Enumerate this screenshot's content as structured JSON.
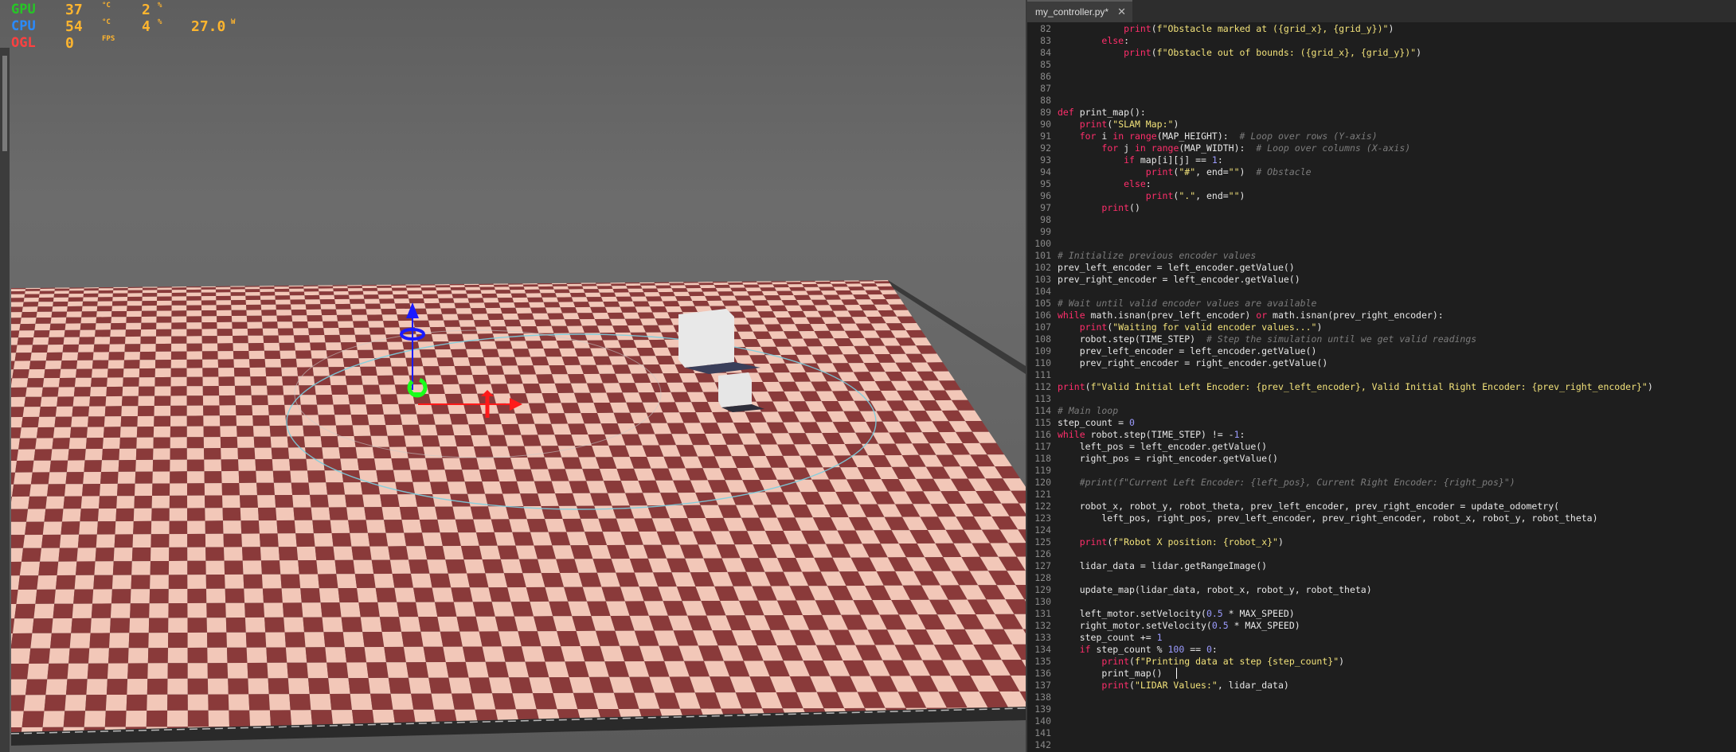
{
  "hud": {
    "rows": [
      {
        "label": "GPU",
        "label_color": "#26c626",
        "v1": "37",
        "u1": "°C",
        "v2": "2",
        "u2": "%",
        "v3": "",
        "u3": ""
      },
      {
        "label": "CPU",
        "label_color": "#2a8bff",
        "v1": "54",
        "u1": "°C",
        "v2": "4",
        "u2": "%",
        "v3": "27.0",
        "u3": "W"
      },
      {
        "label": "OGL",
        "label_color": "#ff4040",
        "v1": "0",
        "u1": "FPS",
        "v2": "",
        "u2": "",
        "v3": "",
        "u3": ""
      }
    ]
  },
  "editor": {
    "tab_title": "my_controller.py*",
    "close_glyph": "✕",
    "lines": [
      {
        "n": "82",
        "t": "            print(f\"Obstacle marked at ({grid_x}, {grid_y})\")"
      },
      {
        "n": "83",
        "t": "        else:"
      },
      {
        "n": "84",
        "t": "            print(f\"Obstacle out of bounds: ({grid_x}, {grid_y})\")"
      },
      {
        "n": "85",
        "t": ""
      },
      {
        "n": "86",
        "t": ""
      },
      {
        "n": "87",
        "t": ""
      },
      {
        "n": "88",
        "t": ""
      },
      {
        "n": "89",
        "t": "def print_map():"
      },
      {
        "n": "90",
        "t": "    print(\"SLAM Map:\")"
      },
      {
        "n": "91",
        "t": "    for i in range(MAP_HEIGHT):  # Loop over rows (Y-axis)"
      },
      {
        "n": "92",
        "t": "        for j in range(MAP_WIDTH):  # Loop over columns (X-axis)"
      },
      {
        "n": "93",
        "t": "            if map[i][j] == 1:"
      },
      {
        "n": "94",
        "t": "                print(\"#\", end=\"\")  # Obstacle"
      },
      {
        "n": "95",
        "t": "            else:"
      },
      {
        "n": "96",
        "t": "                print(\".\", end=\"\")"
      },
      {
        "n": "97",
        "t": "        print()"
      },
      {
        "n": "98",
        "t": ""
      },
      {
        "n": "99",
        "t": ""
      },
      {
        "n": "100",
        "t": ""
      },
      {
        "n": "101",
        "t": "# Initialize previous encoder values"
      },
      {
        "n": "102",
        "t": "prev_left_encoder = left_encoder.getValue()"
      },
      {
        "n": "103",
        "t": "prev_right_encoder = left_encoder.getValue()"
      },
      {
        "n": "104",
        "t": ""
      },
      {
        "n": "105",
        "t": "# Wait until valid encoder values are available"
      },
      {
        "n": "106",
        "t": "while math.isnan(prev_left_encoder) or math.isnan(prev_right_encoder):"
      },
      {
        "n": "107",
        "t": "    print(\"Waiting for valid encoder values...\")"
      },
      {
        "n": "108",
        "t": "    robot.step(TIME_STEP)  # Step the simulation until we get valid readings"
      },
      {
        "n": "109",
        "t": "    prev_left_encoder = left_encoder.getValue()"
      },
      {
        "n": "110",
        "t": "    prev_right_encoder = right_encoder.getValue()"
      },
      {
        "n": "111",
        "t": ""
      },
      {
        "n": "112",
        "t": "print(f\"Valid Initial Left Encoder: {prev_left_encoder}, Valid Initial Right Encoder: {prev_right_encoder}\")"
      },
      {
        "n": "113",
        "t": ""
      },
      {
        "n": "114",
        "t": "# Main loop"
      },
      {
        "n": "115",
        "t": "step_count = 0"
      },
      {
        "n": "116",
        "t": "while robot.step(TIME_STEP) != -1:"
      },
      {
        "n": "117",
        "t": "    left_pos = left_encoder.getValue()"
      },
      {
        "n": "118",
        "t": "    right_pos = right_encoder.getValue()"
      },
      {
        "n": "119",
        "t": ""
      },
      {
        "n": "120",
        "t": "    #print(f\"Current Left Encoder: {left_pos}, Current Right Encoder: {right_pos}\")"
      },
      {
        "n": "121",
        "t": ""
      },
      {
        "n": "122",
        "t": "    robot_x, robot_y, robot_theta, prev_left_encoder, prev_right_encoder = update_odometry("
      },
      {
        "n": "123",
        "t": "        left_pos, right_pos, prev_left_encoder, prev_right_encoder, robot_x, robot_y, robot_theta)"
      },
      {
        "n": "124",
        "t": ""
      },
      {
        "n": "125",
        "t": "    print(f\"Robot X position: {robot_x}\")"
      },
      {
        "n": "126",
        "t": ""
      },
      {
        "n": "127",
        "t": "    lidar_data = lidar.getRangeImage()"
      },
      {
        "n": "128",
        "t": ""
      },
      {
        "n": "129",
        "t": "    update_map(lidar_data, robot_x, robot_y, robot_theta)"
      },
      {
        "n": "130",
        "t": ""
      },
      {
        "n": "131",
        "t": "    left_motor.setVelocity(0.5 * MAX_SPEED)"
      },
      {
        "n": "132",
        "t": "    right_motor.setVelocity(0.5 * MAX_SPEED)"
      },
      {
        "n": "133",
        "t": "    step_count += 1"
      },
      {
        "n": "134",
        "t": "    if step_count % 100 == 0:"
      },
      {
        "n": "135",
        "t": "        print(f\"Printing data at step {step_count}\")"
      },
      {
        "n": "136",
        "t": "        print_map()  "
      },
      {
        "n": "137",
        "t": "        print(\"LIDAR Values:\", lidar_data)"
      },
      {
        "n": "138",
        "t": ""
      },
      {
        "n": "139",
        "t": ""
      },
      {
        "n": "140",
        "t": ""
      },
      {
        "n": "141",
        "t": ""
      },
      {
        "n": "142",
        "t": ""
      }
    ],
    "caret_line": "136"
  },
  "scene": {
    "floor_color_dark": "#8a3a3a",
    "floor_color_light": "#f2c7b8",
    "gizmo_colors": {
      "x": "#ff1a1a",
      "y": "#1aff1a",
      "z": "#1a1aff"
    }
  }
}
